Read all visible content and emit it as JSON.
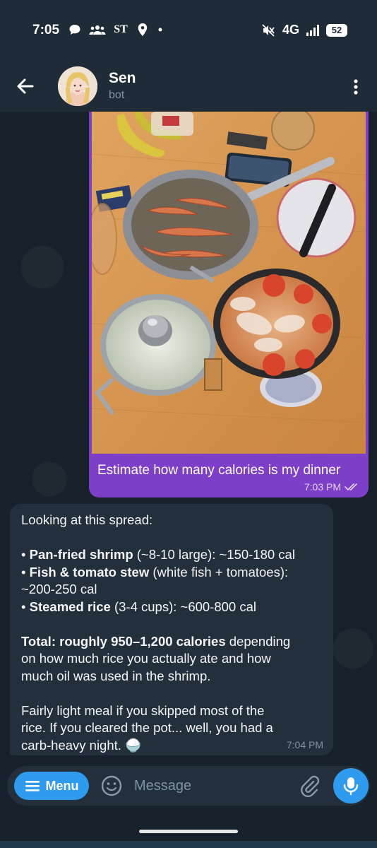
{
  "status_bar": {
    "time": "7:05",
    "network": "4G",
    "battery": "52"
  },
  "header": {
    "name": "Sen",
    "subtitle": "bot"
  },
  "outgoing": {
    "text": "Estimate how many calories is my dinner",
    "time": "7:03 PM",
    "status_icon": "double-check-icon"
  },
  "incoming": {
    "intro": "Looking at this spread:",
    "items": [
      {
        "bullet": "•",
        "label": "Pan-fried shrimp",
        "detail": " (~8-10 large): ~150-180 cal"
      },
      {
        "bullet": "•",
        "label": "Fish & tomato stew",
        "detail": " (white fish + tomatoes):"
      },
      {
        "detail_cont": "~200-250 cal"
      },
      {
        "bullet": "•",
        "label": "Steamed rice",
        "detail": " (3-4 cups): ~600-800 cal"
      }
    ],
    "total_bold": "Total: roughly 950–1,200 calories",
    "total_rest_1": " depending",
    "total_rest_2": "on how much rice you actually ate and how",
    "total_rest_3": "much oil was used in the shrimp.",
    "closing_1": "Fairly light meal if you skipped most of the",
    "closing_2": "rice. If you cleared the pot... well, you had a",
    "closing_3": "carb-heavy night. 🍚",
    "time": "7:04 PM"
  },
  "input_bar": {
    "menu_label": "Menu",
    "placeholder": "Message"
  },
  "colors": {
    "header_bg": "#1f2c37",
    "chat_bg": "#17212b",
    "outgoing_bubble": "#7d3fc8",
    "incoming_bubble": "#232f3b",
    "accent": "#2f9bee"
  }
}
